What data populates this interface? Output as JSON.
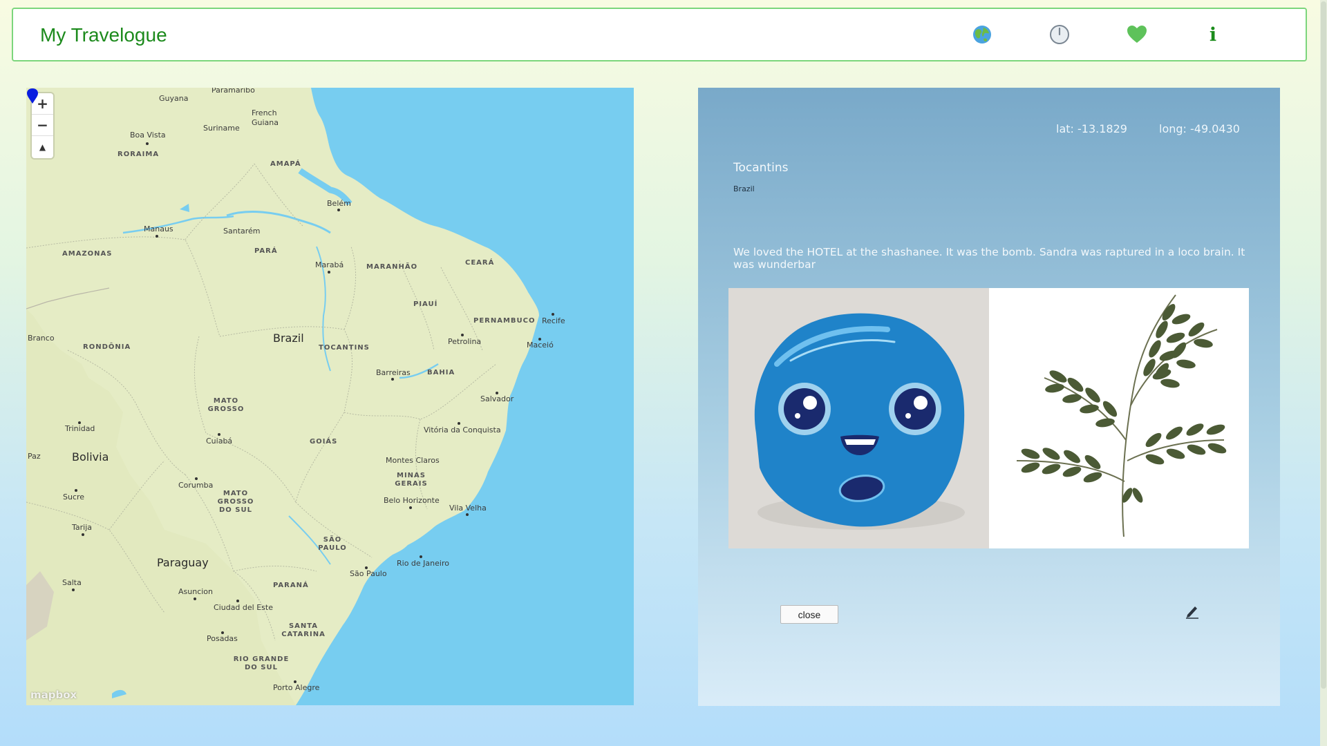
{
  "header": {
    "title": "My Travelogue",
    "nav": [
      {
        "icon": "globe-icon"
      },
      {
        "icon": "clock-icon"
      },
      {
        "icon": "heart-icon"
      },
      {
        "icon": "info-icon",
        "glyph": "i"
      }
    ]
  },
  "map": {
    "zoom_in": "+",
    "zoom_out": "−",
    "compass": "▲",
    "attribution": "mapbox",
    "labels": {
      "guyana": "Guyana",
      "paramaribo": "Paramaribo",
      "french_guiana": "French Guiana",
      "suriname": "Suriname",
      "boa_vista": "Boa Vista",
      "roraima": "RORAIMA",
      "amapa": "AMAPÁ",
      "belem": "Belém",
      "manaus": "Manaus",
      "santarem": "Santarém",
      "amazonas": "AMAZONAS",
      "para": "PARÁ",
      "maraba": "Marabá",
      "maranhao": "MARANHÃO",
      "ceara": "CEARÁ",
      "piaui": "PIAUÍ",
      "pernambuco": "PERNAMBUCO",
      "recife": "Recife",
      "branco": "Branco",
      "rondonia": "RONDÔNIA",
      "brazil": "Brazil",
      "tocantins": "TOCANTINS",
      "petrolina": "Petrolina",
      "maceio": "Maceió",
      "barreiras": "Barreiras",
      "bahia": "BAHIA",
      "salvador": "Salvador",
      "mato_grosso": "MATO GROSSO",
      "trinidad": "Trinidad",
      "cuiaba": "Cuiabá",
      "goias": "GOIÁS",
      "vitoria": "Vitória da Conquista",
      "paz": "Paz",
      "bolivia": "Bolivia",
      "montes_claros": "Montes Claros",
      "minas_gerais": "MINAS GERAIS",
      "corumba": "Corumba",
      "sucre": "Sucre",
      "mato_grosso_sul": "MATO GROSSO DO SUL",
      "belo_horizonte": "Belo Horizonte",
      "vila_velha": "Vila Velha",
      "tarija": "Tarija",
      "sao_paulo_state": "SÃO PAULO",
      "paraguay": "Paraguay",
      "rio": "Rio de Janeiro",
      "sao_paulo": "São Paulo",
      "salta": "Salta",
      "asuncion": "Asuncion",
      "parana": "PARANÁ",
      "ciudad_del_este": "Ciudad del Este",
      "santa_catarina": "SANTA CATARINA",
      "posadas": "Posadas",
      "rio_grande": "RIO GRANDE DO SUL",
      "porto_alegre": "Porto Alegre"
    }
  },
  "detail": {
    "lat": "lat: -13.1829",
    "long": "long: -49.0430",
    "place": "Tocantins",
    "country": "Brazil",
    "note": "We loved the HOTEL at the shashanee. It was the bomb. Sandra was raptured in a loco brain. It was wunderbar",
    "photos": [
      {
        "subject": "blue smiling pillow"
      },
      {
        "subject": "green leaf branch"
      }
    ],
    "close_label": "close",
    "edit_icon": "pencil-icon"
  },
  "colors": {
    "brand": "#1c8a1c",
    "header_border": "#7cd67c",
    "map_water": "#77cdf0",
    "map_land": "#e5ecc5",
    "pin": "#0a1ee0",
    "panel_top": "#79a9c9",
    "panel_bottom": "#d9ecf8"
  }
}
